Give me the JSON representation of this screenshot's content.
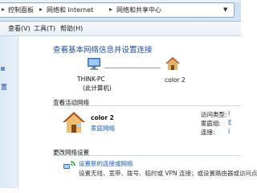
{
  "breadcrumb": {
    "items": [
      "控制面板",
      "网络和 Internet",
      "网络和共享中心"
    ],
    "separator": "▸"
  },
  "menubar": {
    "items": [
      "查看(V)",
      "工具(T)",
      "帮助(H)"
    ]
  },
  "sidebar": {
    "link_fragment": "置"
  },
  "main": {
    "title": "查看基本网络信息并设置连接",
    "computer": {
      "name": "THINK-PC",
      "subtitle": "(此计算机)"
    },
    "network": {
      "name": "color  2"
    },
    "active_section_label": "查看活动网络",
    "active_network": {
      "name": "color  2",
      "type_link": "家庭网络",
      "properties": [
        {
          "key": "访问类型:",
          "value": "I"
        },
        {
          "key": "家庭组:",
          "value": "E"
        },
        {
          "key": "连接:",
          "value": "I"
        }
      ]
    },
    "change_section_label": "更改网络设置",
    "setup": {
      "link": "设置新的连接或网络",
      "description": "设置无线、宽带、拨号、临时或 VPN 连接；或设置路由器或访问点"
    }
  },
  "colors": {
    "link": "#1e5ebf",
    "title": "#1e4e9b",
    "sidebar": "#dbe8f5"
  }
}
